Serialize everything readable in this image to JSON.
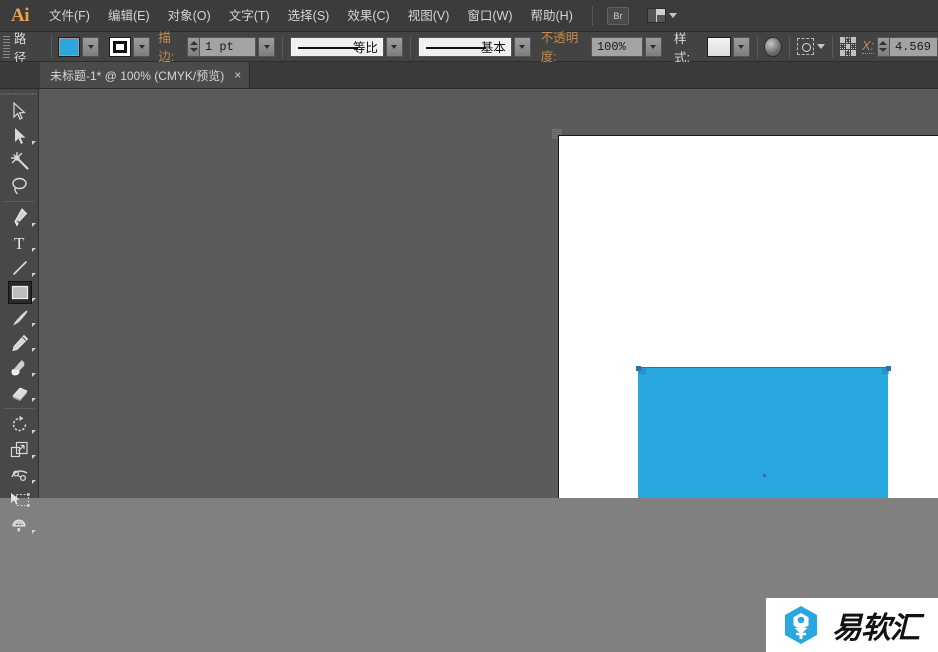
{
  "app": {
    "name": "Ai",
    "logo_color": "#e2a44a"
  },
  "menubar": {
    "items": [
      {
        "label": "文件(F)",
        "name": "menu-file"
      },
      {
        "label": "编辑(E)",
        "name": "menu-edit"
      },
      {
        "label": "对象(O)",
        "name": "menu-object"
      },
      {
        "label": "文字(T)",
        "name": "menu-type"
      },
      {
        "label": "选择(S)",
        "name": "menu-select"
      },
      {
        "label": "效果(C)",
        "name": "menu-effect"
      },
      {
        "label": "视图(V)",
        "name": "menu-view"
      },
      {
        "label": "窗口(W)",
        "name": "menu-window"
      },
      {
        "label": "帮助(H)",
        "name": "menu-help"
      }
    ],
    "bridge_button": "Br",
    "arrange_label": ""
  },
  "controlbar": {
    "selection_label": "路径",
    "fill_color": "#29a8e0",
    "stroke_label": "描边:",
    "stroke_weight": "1 pt",
    "profile_label": "等比",
    "brush_label": "基本",
    "opacity_label": "不透明度:",
    "opacity_value": "100%",
    "style_label": "样式:",
    "x_label": "X:",
    "x_value": "4.569"
  },
  "tabbar": {
    "tab_title": "未标题-1* @ 100% (CMYK/预览)",
    "close_glyph": "×"
  },
  "tools": [
    {
      "name": "selection-tool",
      "label": "选择工具",
      "selected": false
    },
    {
      "name": "direct-selection-tool",
      "label": "直接选择工具",
      "selected": false
    },
    {
      "name": "magic-wand-tool",
      "label": "魔棒工具",
      "selected": false
    },
    {
      "name": "lasso-tool",
      "label": "套索工具",
      "selected": false
    },
    {
      "name": "pen-tool",
      "label": "钢笔工具",
      "selected": false
    },
    {
      "name": "type-tool",
      "label": "文字工具",
      "selected": false
    },
    {
      "name": "line-segment-tool",
      "label": "直线段工具",
      "selected": false
    },
    {
      "name": "rectangle-tool",
      "label": "矩形工具",
      "selected": true
    },
    {
      "name": "paintbrush-tool",
      "label": "画笔工具",
      "selected": false
    },
    {
      "name": "pencil-tool",
      "label": "铅笔工具",
      "selected": false
    },
    {
      "name": "blob-brush-tool",
      "label": "斑点画笔工具",
      "selected": false
    },
    {
      "name": "eraser-tool",
      "label": "橡皮擦工具",
      "selected": false
    },
    {
      "name": "rotate-tool",
      "label": "旋转工具",
      "selected": false
    },
    {
      "name": "scale-tool",
      "label": "比例缩放工具",
      "selected": false
    },
    {
      "name": "width-tool",
      "label": "宽度工具",
      "selected": false
    },
    {
      "name": "free-transform-tool",
      "label": "自由变换工具",
      "selected": false
    },
    {
      "name": "shape-builder-tool",
      "label": "形状生成器工具",
      "selected": false
    }
  ],
  "canvas": {
    "background_color": "#5b5b5b",
    "artboard_color": "#ffffff",
    "shape": {
      "name": "rectangle",
      "fill": "#29a8e0",
      "selected": true
    }
  },
  "watermark": {
    "text": "易软汇"
  }
}
